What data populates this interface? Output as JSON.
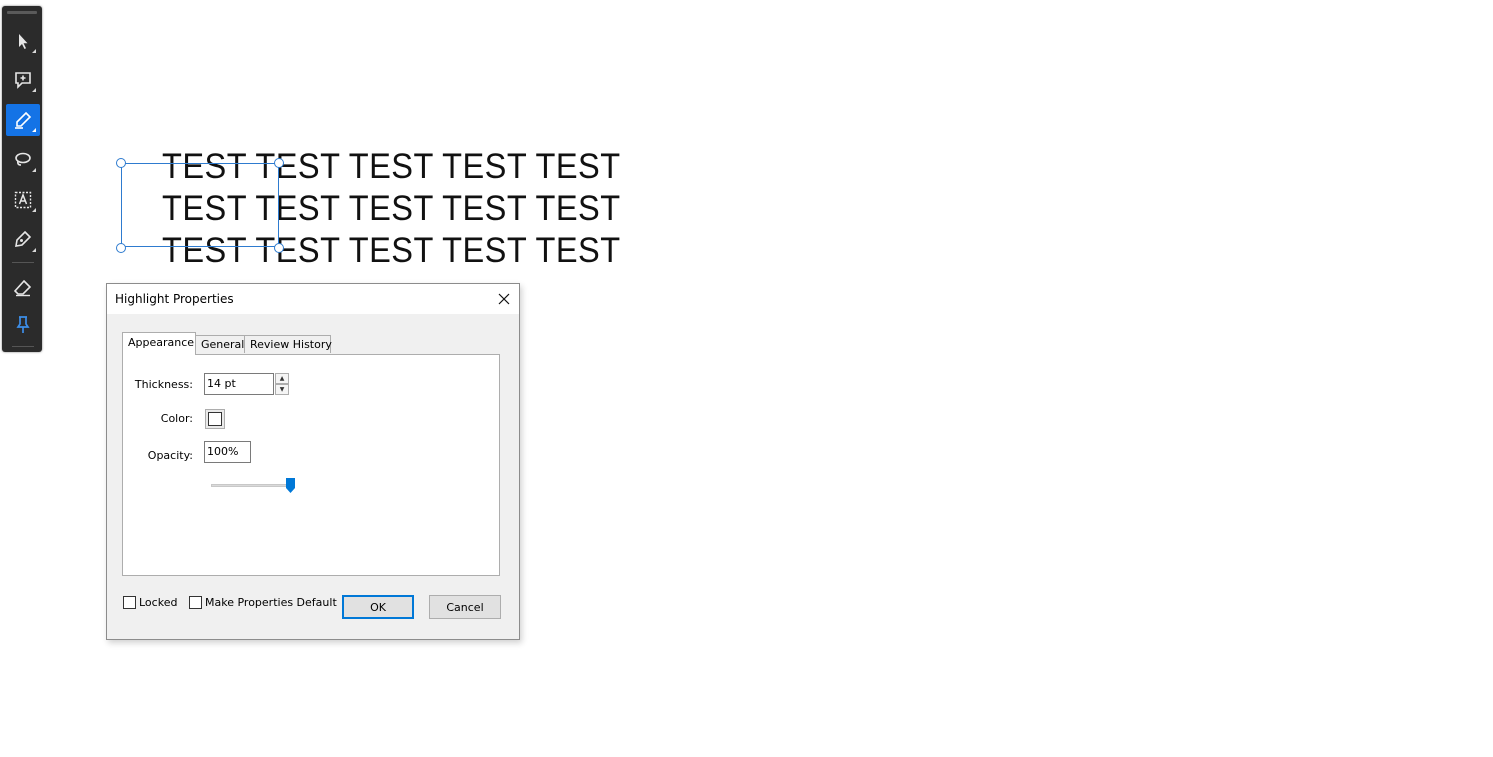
{
  "toolbar": {
    "tools": [
      {
        "name": "select-tool",
        "icon": "arrow-cursor-icon",
        "active": false
      },
      {
        "name": "comment-tool",
        "icon": "add-comment-icon",
        "active": false
      },
      {
        "name": "highlight-tool",
        "icon": "highlighter-pen-icon",
        "active": true
      },
      {
        "name": "lasso-tool",
        "icon": "lasso-icon",
        "active": false
      },
      {
        "name": "text-box-tool",
        "icon": "text-box-icon",
        "active": false
      },
      {
        "name": "draw-tool",
        "icon": "pen-draw-icon",
        "active": false
      },
      {
        "name": "eraser-tool",
        "icon": "eraser-icon",
        "active": false
      },
      {
        "name": "pin-tool",
        "icon": "pin-icon",
        "active": false
      }
    ],
    "accent_color": "#1473e6"
  },
  "document": {
    "lines": [
      "TEST TEST TEST TEST TEST",
      "TEST TEST TEST TEST TEST",
      "TEST TEST TEST TEST TEST"
    ],
    "selection_color": "#2e7bcf"
  },
  "dialog": {
    "title": "Highlight Properties",
    "tabs": [
      {
        "label": "Appearance",
        "active": true
      },
      {
        "label": "General",
        "active": false
      },
      {
        "label": "Review History",
        "active": false
      }
    ],
    "appearance": {
      "thickness_label": "Thickness:",
      "thickness_value": "14 pt",
      "color_label": "Color:",
      "color_value": "#ffffff",
      "opacity_label": "Opacity:",
      "opacity_value": "100%",
      "opacity_slider_fraction": 1.0
    },
    "footer": {
      "locked_label": "Locked",
      "locked_checked": false,
      "make_default_label": "Make Properties Default",
      "make_default_checked": false,
      "ok_label": "OK",
      "cancel_label": "Cancel"
    }
  }
}
